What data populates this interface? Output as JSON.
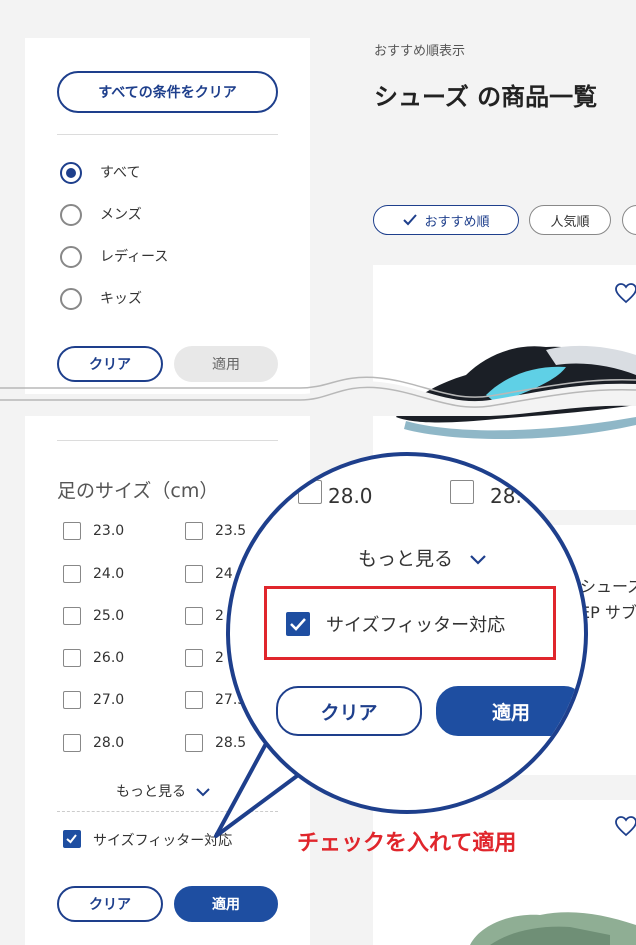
{
  "sidebar": {
    "clear_all": "すべての条件をクリア",
    "gender_options": [
      "すべて",
      "メンズ",
      "レディース",
      "キッズ"
    ],
    "clear": "クリア",
    "apply": "適用",
    "size_title": "足のサイズ（cm）",
    "sizes_left": [
      "23.0",
      "24.0",
      "25.0",
      "26.0",
      "27.0",
      "28.0"
    ],
    "sizes_right": [
      "23.5",
      "24",
      "2",
      "2",
      "27.5",
      "28.5"
    ],
    "more": "もっと見る",
    "size_fitter": "サイズフィッター対応"
  },
  "main": {
    "sort_caption": "おすすめ順表示",
    "title": "シューズ の商品一覧",
    "sort_tags": [
      "おすすめ順",
      "人気順"
    ],
    "product_partial_1": "シューズ",
    "product_partial_2": "EP サブ"
  },
  "magnifier": {
    "size_a": "28.0",
    "size_b": "28.",
    "more": "もっと見る",
    "size_fitter": "サイズフィッター対応",
    "clear": "クリア",
    "apply": "適用"
  },
  "annotation": "チェックを入れて適用",
  "colors": {
    "brand": "#1e3f8c",
    "apply_fill": "#1e4ea1",
    "highlight": "#e0262c"
  }
}
